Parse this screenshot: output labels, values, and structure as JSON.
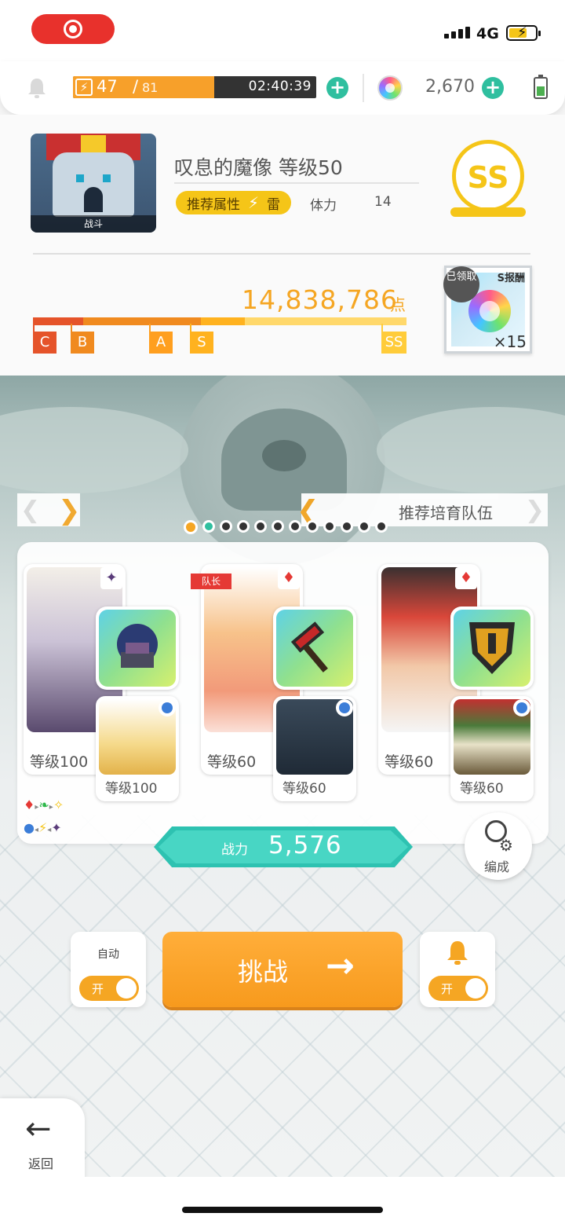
{
  "status_bar": {
    "network": "4G",
    "battery_charging": true
  },
  "resources": {
    "stamina_current": "47",
    "stamina_separator": "/",
    "stamina_max": "81",
    "stamina_fraction": 0.58,
    "stamina_timer": "02:40:39",
    "gem_count": "2,670"
  },
  "quest": {
    "boss_thumb_tag": "战斗",
    "title": "叹息的魔像 等级50",
    "recommended_attr_label": "推荐属性",
    "recommended_attr_value": "雷",
    "stamina_label": "体力",
    "stamina_cost": "14",
    "rank": "SS",
    "score": "14,838,786",
    "score_unit": "点",
    "rank_marks": [
      "C",
      "B",
      "A",
      "S",
      "SS"
    ],
    "reward_header": "S报酬",
    "reward_claimed": "已领取",
    "reward_qty": "×15"
  },
  "team": {
    "pager_label": "推荐培育队伍",
    "page_count": 12,
    "active_page": 1,
    "leader_tag": "队长",
    "units": [
      {
        "level": "等级100",
        "element": "dark",
        "support_level": "等级100"
      },
      {
        "level": "等级60",
        "element": "fire",
        "support_level": "等级60"
      },
      {
        "level": "等级60",
        "element": "fire",
        "support_level": "等级60"
      }
    ],
    "power_label": "战力",
    "power_value": "5,576",
    "formation_label": "编成"
  },
  "controls": {
    "auto_label": "自动",
    "auto_state": "开",
    "notify_state": "开",
    "challenge_label": "挑战",
    "back_label": "返回"
  },
  "colors": {
    "accent_orange": "#f5a623",
    "accent_teal": "#2fbf9f",
    "rank_gold": "#f5c518"
  }
}
